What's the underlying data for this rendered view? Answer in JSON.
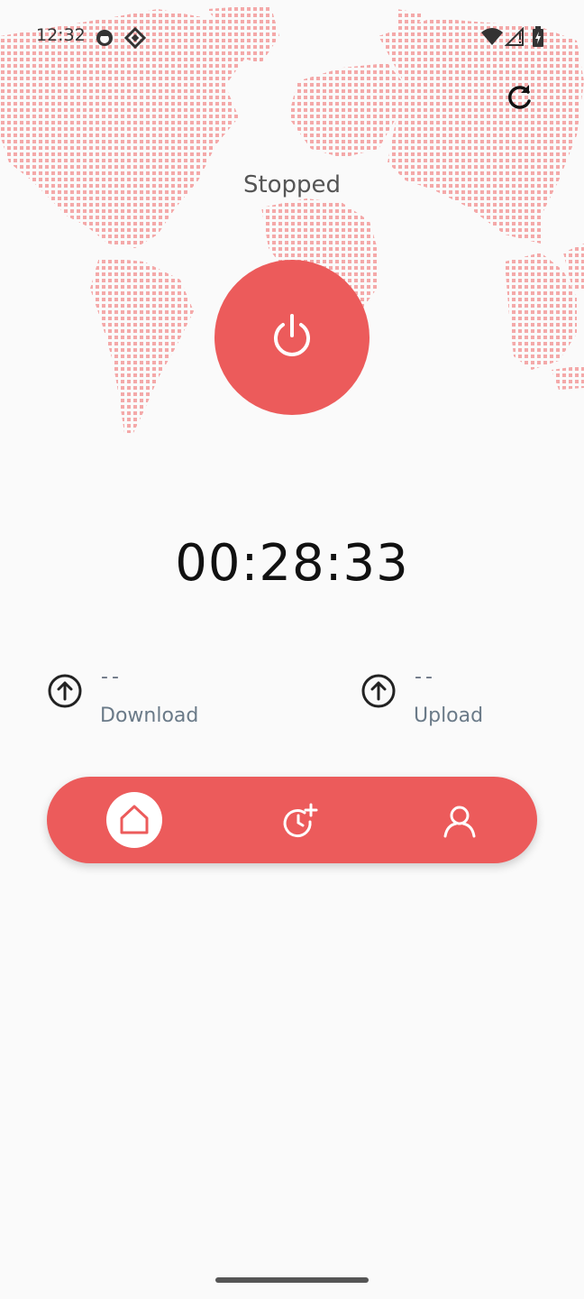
{
  "status_bar": {
    "time": "12:32"
  },
  "connection": {
    "status": "Stopped",
    "timer": "00:28:33"
  },
  "stats": {
    "download": {
      "value": "--",
      "label": "Download"
    },
    "upload": {
      "value": "--",
      "label": "Upload"
    }
  },
  "nav": {
    "items": [
      {
        "icon": "home-icon",
        "active": true
      },
      {
        "icon": "history-add-icon",
        "active": false
      },
      {
        "icon": "account-icon",
        "active": false
      }
    ]
  },
  "colors": {
    "accent": "#ec5b5b",
    "map_dots": "#f4a9a9",
    "background": "#fafafa"
  }
}
